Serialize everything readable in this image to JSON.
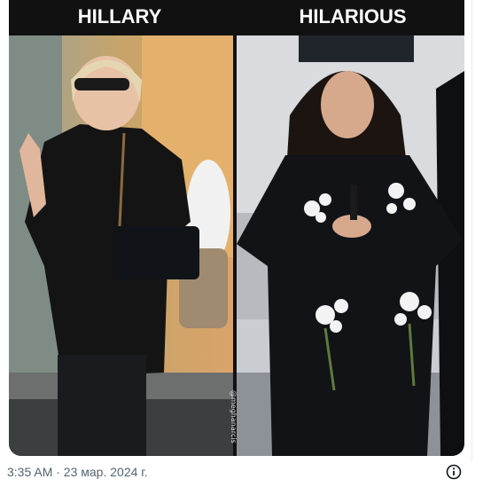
{
  "meme": {
    "left_caption": "HILLARY",
    "right_caption": "HILARIOUS",
    "watermark": "@meghanarcis"
  },
  "footer": {
    "timestamp": "3:35 AM · 23 мар. 2024 г."
  },
  "colors": {
    "meme_background": "#111111",
    "caption_text": "#ffffff",
    "meta_text": "#536471"
  },
  "icons": {
    "info": "info-circle-icon"
  }
}
